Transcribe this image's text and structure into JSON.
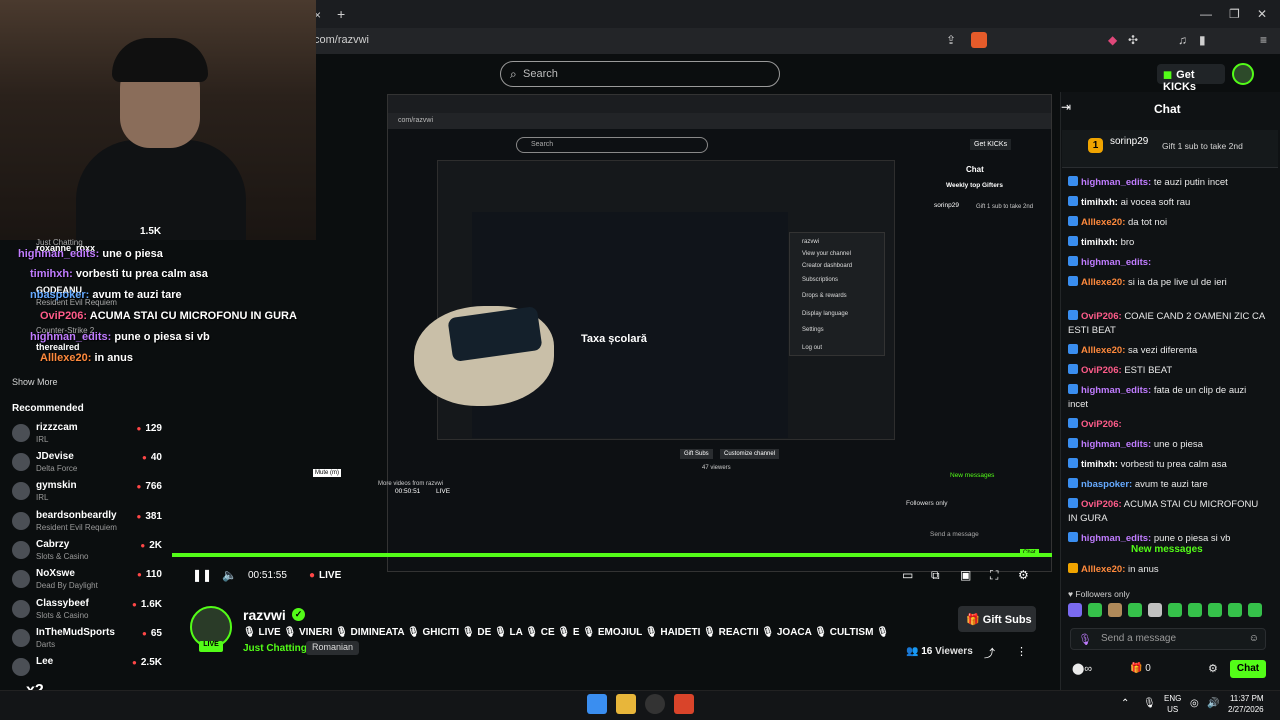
{
  "browser": {
    "address": "com/razvwi",
    "tab_close": "×",
    "tab_new": "+",
    "window_controls": [
      "—",
      "❐",
      "✕"
    ]
  },
  "topnav": {
    "search_placeholder": "Search",
    "get_kicks_label": "Get KICKs"
  },
  "overlay_chat": [
    {
      "user": "highman_edits:",
      "text": "une o piesa"
    },
    {
      "user": "timihxh:",
      "text": "vorbesti tu prea calm asa"
    },
    {
      "user": "nbaspoker:",
      "text": "avum te auzi tare"
    },
    {
      "user": "OviP206:",
      "text": "ACUMA STAI CU MICROFONU IN GURA"
    },
    {
      "user": "highman_edits:",
      "text": "pune o piesa si vb"
    },
    {
      "user": "Alllexe20:",
      "text": "in anus"
    }
  ],
  "overlay_extra": {
    "count_1": "1.5K",
    "rec_1_name": "roxanne_roxx",
    "rec_1_cat": "Just Chatting",
    "rec_2_name": "GODEANU",
    "rec_2_cat": "Resident Evil Requiem",
    "rec_3_cat": "Counter-Strike 2",
    "rec_4_name": "therealred",
    "x2": "x2"
  },
  "sidebar": {
    "show_more": "Show More",
    "recommended_title": "Recommended",
    "items": [
      {
        "name": "rizzzcam",
        "category": "IRL",
        "viewers": "129"
      },
      {
        "name": "JDevise",
        "category": "Delta Force",
        "viewers": "40"
      },
      {
        "name": "gymskin",
        "category": "IRL",
        "viewers": "766"
      },
      {
        "name": "beardsonbeardly",
        "category": "Resident Evil Requiem",
        "viewers": "381"
      },
      {
        "name": "Cabrzy",
        "category": "Slots & Casino",
        "viewers": "2K"
      },
      {
        "name": "NoXswe",
        "category": "Dead By Daylight",
        "viewers": "110"
      },
      {
        "name": "Classybeef",
        "category": "Slots & Casino",
        "viewers": "1.6K"
      },
      {
        "name": "InTheMudSports",
        "category": "Darts",
        "viewers": "65"
      },
      {
        "name": "Lee",
        "category": "",
        "viewers": "2.5K"
      }
    ]
  },
  "inner_screen": {
    "address": "com/razvwi",
    "search_placeholder": "Search",
    "get_kicks": "Get KICKs",
    "chat_title": "Chat",
    "weekly_gifters": "Weekly top Gifters",
    "pinned_user": "sorinp29",
    "pinned_text": "Gift 1 sub to take 2nd",
    "taxa_title": "Taxa școlară",
    "dropdown": [
      "razvwi",
      "View your channel",
      "Creator dashboard",
      "Subscriptions",
      "Drops & rewards",
      "Display language",
      "Settings",
      "Log out"
    ],
    "new_messages": "New messages",
    "followers_only": "Followers only",
    "send_placeholder": "Send a message",
    "chat_button": "Chat",
    "more_videos": "More videos from razvwi",
    "time": "00:50:51",
    "live": "LIVE",
    "viewers": "47 viewers",
    "gift_subs": "Gift Subs",
    "customize": "Customize channel",
    "mute_tip": "Mute (m)"
  },
  "player": {
    "time": "00:51:55",
    "live_label": "LIVE",
    "progress_fraction": 1.0
  },
  "stream": {
    "channel_name": "razvwi",
    "live_badge": "LIVE",
    "title": "🎙 LIVE 🎙 VINERI 🎙 DIMINEATA 🎙 GHICITI 🎙 DE 🎙 LA 🎙 CE 🎙 E 🎙 EMOJIUL 🎙 HAIDETI 🎙 REACTII 🎙 JOACA 🎙 CULTISM 🎙",
    "category": "Just Chatting",
    "language": "Romanian",
    "gift_subs": "Gift Subs",
    "viewer_count": "16",
    "viewers_label": "Viewers"
  },
  "chat": {
    "title": "Chat",
    "pinned_user": "sorinp29",
    "pinned_count": "1",
    "pinned_text": "Gift 1 sub to take 2nd",
    "messages": [
      {
        "user": "highman_edits:",
        "text": "te auzi putin incet",
        "color": "#c07cff"
      },
      {
        "user": "timihxh:",
        "text": "ai vocea soft rau",
        "color": "#ffffff"
      },
      {
        "user": "Alllexe20:",
        "text": "da tot noi",
        "color": "#ff8a3d"
      },
      {
        "user": "timihxh:",
        "text": "bro",
        "color": "#ffffff"
      },
      {
        "user": "highman_edits:",
        "text": "",
        "color": "#c07cff"
      },
      {
        "user": "Alllexe20:",
        "text": "si ia da pe live ul de ieri",
        "color": "#ff8a3d"
      },
      {
        "user": "OviP206:",
        "text": "COAIE CAND 2 OAMENI ZIC CA ESTI BEAT",
        "color": "#ff5c8a"
      },
      {
        "user": "Alllexe20:",
        "text": "sa vezi diferenta",
        "color": "#ff8a3d"
      },
      {
        "user": "OviP206:",
        "text": "ESTI BEAT",
        "color": "#ff5c8a"
      },
      {
        "user": "highman_edits:",
        "text": "fata de un clip de auzi incet",
        "color": "#c07cff"
      },
      {
        "user": "OviP206:",
        "text": "",
        "color": "#ff5c8a"
      },
      {
        "user": "highman_edits:",
        "text": "une o piesa",
        "color": "#c07cff"
      },
      {
        "user": "timihxh:",
        "text": "vorbesti tu prea calm asa",
        "color": "#ffffff"
      },
      {
        "user": "nbaspoker:",
        "text": "avum te auzi tare",
        "color": "#66aaff"
      },
      {
        "user": "OviP206:",
        "text": "ACUMA STAI CU MICROFONU IN GURA",
        "color": "#ff5c8a"
      },
      {
        "user": "highman_edits:",
        "text": "pune o piesa si vb",
        "color": "#c07cff"
      }
    ],
    "new_messages": "New messages",
    "after_new": [
      {
        "user": "Alllexe20:",
        "text": "in anus",
        "color": "#ff8a3d"
      }
    ],
    "followers_only": "Followers only",
    "send_placeholder": "Send a message",
    "kicks_count": "0",
    "chat_button": "Chat"
  },
  "taskbar": {
    "lang_1": "ENG",
    "lang_2": "US",
    "time": "11:37 PM",
    "date": "2/27/2026"
  },
  "colors": {
    "kick_green": "#53fc18",
    "live_red": "#ff4747",
    "background": "#0b0e0f"
  }
}
